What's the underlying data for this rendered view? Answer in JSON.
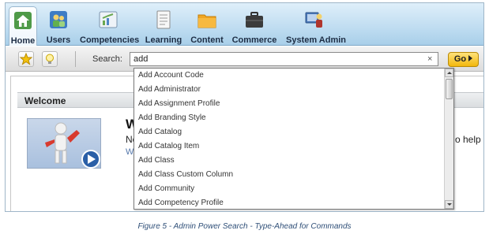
{
  "nav": {
    "items": [
      {
        "label": "Home",
        "icon": "home-icon"
      },
      {
        "label": "Users",
        "icon": "users-icon"
      },
      {
        "label": "Competencies",
        "icon": "competencies-icon"
      },
      {
        "label": "Learning",
        "icon": "learning-icon"
      },
      {
        "label": "Content",
        "icon": "content-icon"
      },
      {
        "label": "Commerce",
        "icon": "commerce-icon"
      },
      {
        "label": "System Admin",
        "icon": "system-admin-icon"
      }
    ],
    "active": "Home"
  },
  "search": {
    "label": "Search:",
    "value": "add",
    "clear": "×",
    "go_label": "Go",
    "favorites_icon": "star-icon",
    "tips_icon": "lightbulb-icon"
  },
  "welcome": {
    "title": "Welcome",
    "heading": "W",
    "line1": "Ne",
    "line2": "Wa",
    "cut_text": "o help yo"
  },
  "dropdown": {
    "items": [
      "Add Account Code",
      "Add Administrator",
      "Add Assignment Profile",
      "Add Branding Style",
      "Add Catalog",
      "Add Catalog Item",
      "Add Class",
      "Add Class Custom Column",
      "Add Community",
      "Add Competency Profile"
    ]
  },
  "caption": "Figure 5 - Admin Power Search - Type-Ahead for Commands",
  "colors": {
    "nav_bg": "#b9d9ef",
    "go_button": "#f2b70c",
    "caption": "#2f4f78"
  }
}
